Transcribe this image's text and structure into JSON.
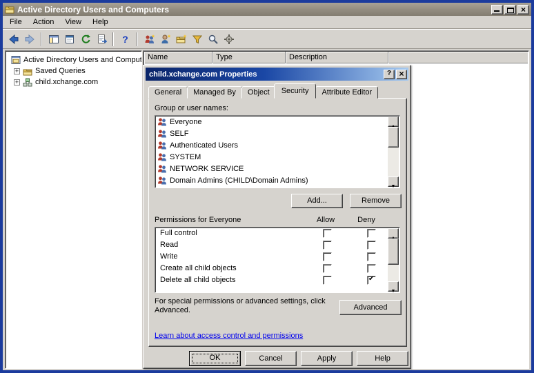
{
  "window": {
    "title": "Active Directory Users and Computers",
    "menu": [
      "File",
      "Action",
      "View",
      "Help"
    ],
    "columns": [
      "Name",
      "Type",
      "Description"
    ],
    "tree": {
      "root": "Active Directory Users and Comput",
      "saved_queries": "Saved Queries",
      "domain": "child.xchange.com"
    },
    "toolbar_icons": [
      "back-icon",
      "forward-icon",
      "show-console-tree-icon",
      "properties-icon",
      "refresh-icon",
      "export-list-icon",
      "help-icon",
      "create-group-icon",
      "create-user-icon",
      "create-ou-icon",
      "filter-icon",
      "find-icon",
      "advanced-options-icon"
    ]
  },
  "dialog": {
    "title": "child.xchange.com Properties",
    "tabs": [
      "General",
      "Managed By",
      "Object",
      "Security",
      "Attribute Editor"
    ],
    "active_tab": "Security",
    "security": {
      "group_label": "Group or user names:",
      "groups": [
        "Everyone",
        "SELF",
        "Authenticated Users",
        "SYSTEM",
        "NETWORK SERVICE",
        "Domain Admins (CHILD\\Domain Admins)"
      ],
      "add": "Add...",
      "remove": "Remove",
      "permissions_label": "Permissions for Everyone",
      "allow": "Allow",
      "deny": "Deny",
      "permissions": [
        {
          "name": "Full control",
          "allow": false,
          "deny": false
        },
        {
          "name": "Read",
          "allow": false,
          "deny": false
        },
        {
          "name": "Write",
          "allow": false,
          "deny": false
        },
        {
          "name": "Create all child objects",
          "allow": false,
          "deny": false
        },
        {
          "name": "Delete all child objects",
          "allow": false,
          "deny": true
        }
      ],
      "advanced_text": "For special permissions or advanced settings, click Advanced.",
      "advanced": "Advanced",
      "link": "Learn about access control and permissions"
    },
    "buttons": {
      "ok": "OK",
      "cancel": "Cancel",
      "apply": "Apply",
      "help": "Help"
    }
  },
  "colors": {
    "frame": "#1b3b9d",
    "classic_gray": "#d6d3ce",
    "dialog_title_start": "#0b2569",
    "dialog_title_end": "#a6caf0",
    "link": "#0000ee"
  }
}
